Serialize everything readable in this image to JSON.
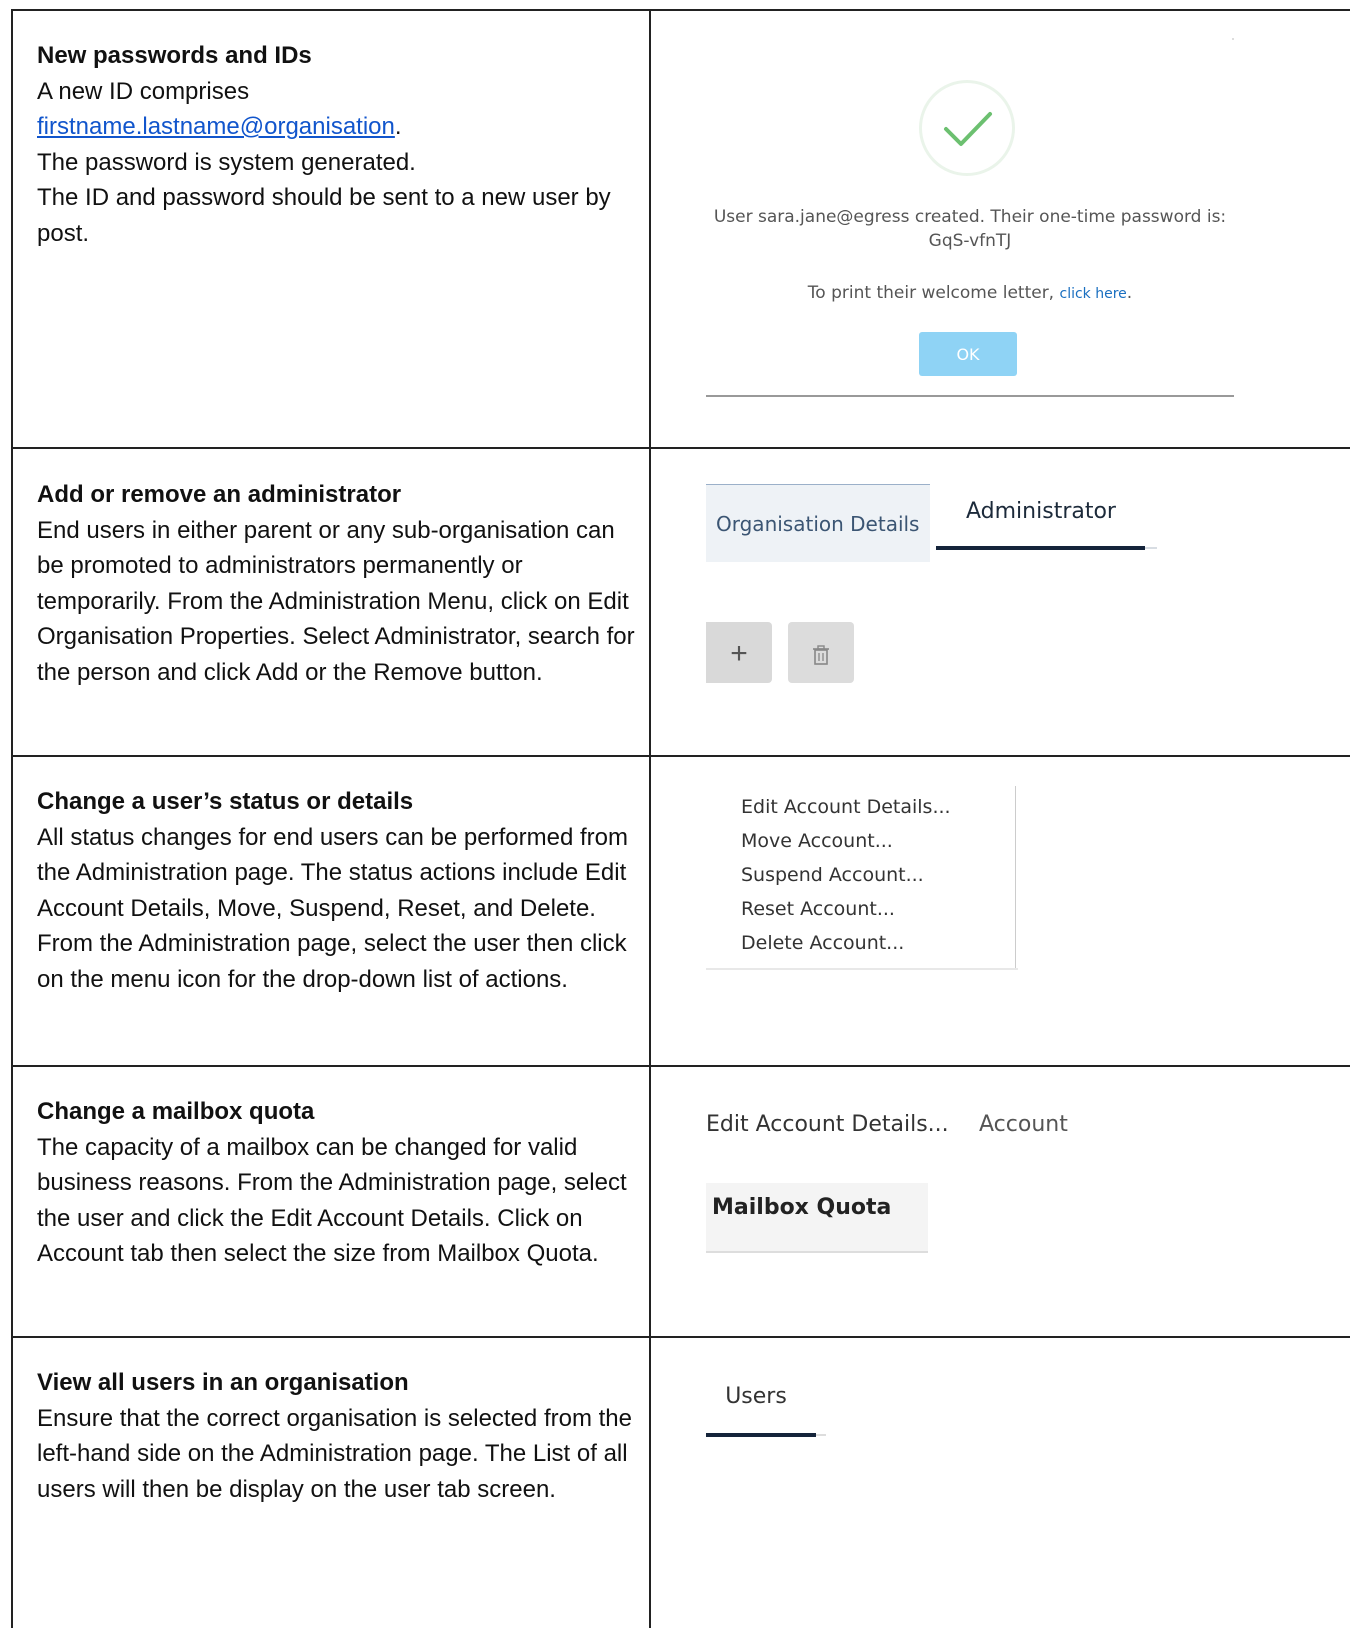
{
  "rows": [
    {
      "heading": "New passwords and IDs",
      "line1": "A new ID comprises",
      "link": "firstname.lastname@organisation",
      "line1_end": ".",
      "line2": "The password is system generated.",
      "line3": "The ID and password should be sent to a new user by post."
    },
    {
      "heading": "Add or remove an administrator",
      "body": "End users in either parent or any sub-organisation can be promoted to administrators permanently or temporarily. From the Administration Menu, click on Edit Organisation Properties. Select Administrator, search for the person and click Add or the Remove button."
    },
    {
      "heading": "Change a user’s status or details",
      "body": "All status changes for end users can be performed from the Administration page. The status actions include Edit Account Details, Move, Suspend, Reset, and Delete. From the Administration page, select the user then click on the menu icon for the drop-down list of actions."
    },
    {
      "heading": "Change a mailbox quota",
      "body": "The capacity of a mailbox can be changed for valid business reasons. From the Administration page, select the user and click the Edit Account Details. Click on Account tab then select the size from Mailbox Quota."
    },
    {
      "heading": "View all users in an organisation",
      "body": "Ensure that the correct organisation is selected from the left-hand side on the Administration page. The List of all users will then be display on the user tab screen."
    }
  ],
  "dialog": {
    "message": "User sara.jane@egress created. Their one-time password is: GqS-vfnTJ",
    "print_prefix": "To print their welcome letter, ",
    "print_link": "click here",
    "print_suffix": ".",
    "ok_label": "OK",
    "success_color": "#6cc070",
    "ok_color": "#8fd3f5"
  },
  "org_tabs": {
    "tab1": "Organisation Details",
    "tab2": "Administrator",
    "add_icon": "plus-icon",
    "delete_icon": "trash-icon"
  },
  "account_menu": {
    "items": [
      "Edit Account Details...",
      "Move Account...",
      "Suspend Account...",
      "Reset Account...",
      "Delete Account..."
    ]
  },
  "edit_account": {
    "tab1": "Edit Account Details...",
    "tab2": "Account",
    "field": "Mailbox Quota"
  },
  "users_tab": {
    "label": "Users"
  }
}
